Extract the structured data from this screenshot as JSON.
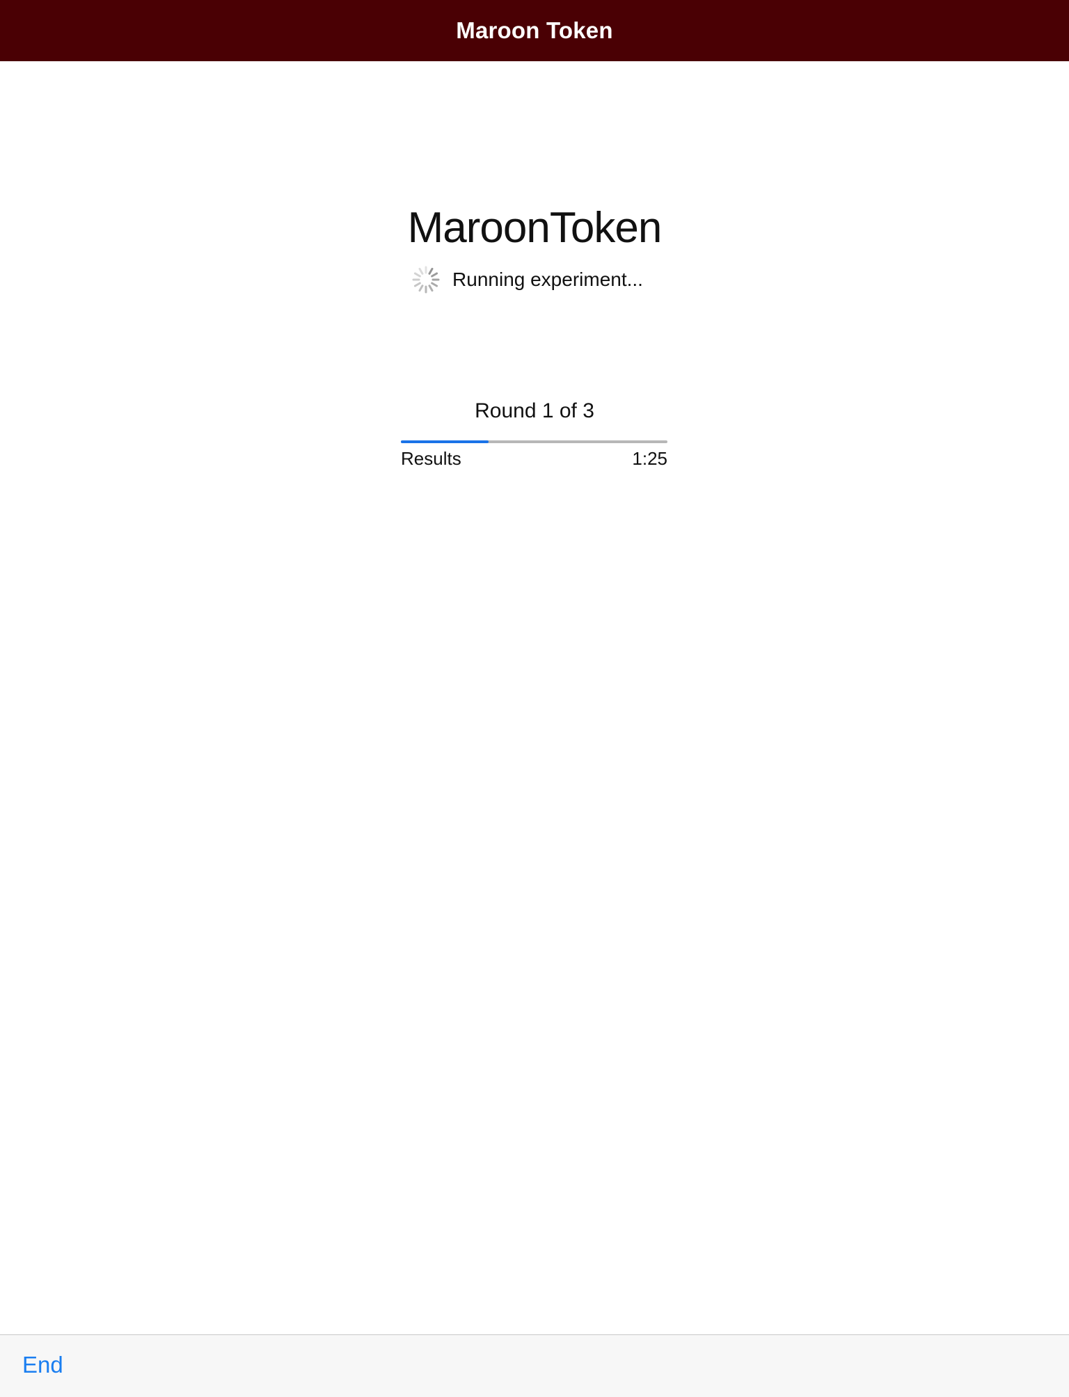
{
  "nav": {
    "title": "Maroon Token",
    "background": "#4a0004"
  },
  "main": {
    "app_name": "MaroonToken",
    "status_text": "Running experiment...",
    "spinner_icon": "activity-spinner-icon",
    "round_label": "Round 1 of 3",
    "progress": {
      "fraction": 0.33,
      "left_label": "Results",
      "right_label": "1:25",
      "fill_color": "#1a73e8",
      "track_color": "#b7b7b7"
    }
  },
  "toolbar": {
    "end_label": "End",
    "accent": "#1a7ef0"
  }
}
